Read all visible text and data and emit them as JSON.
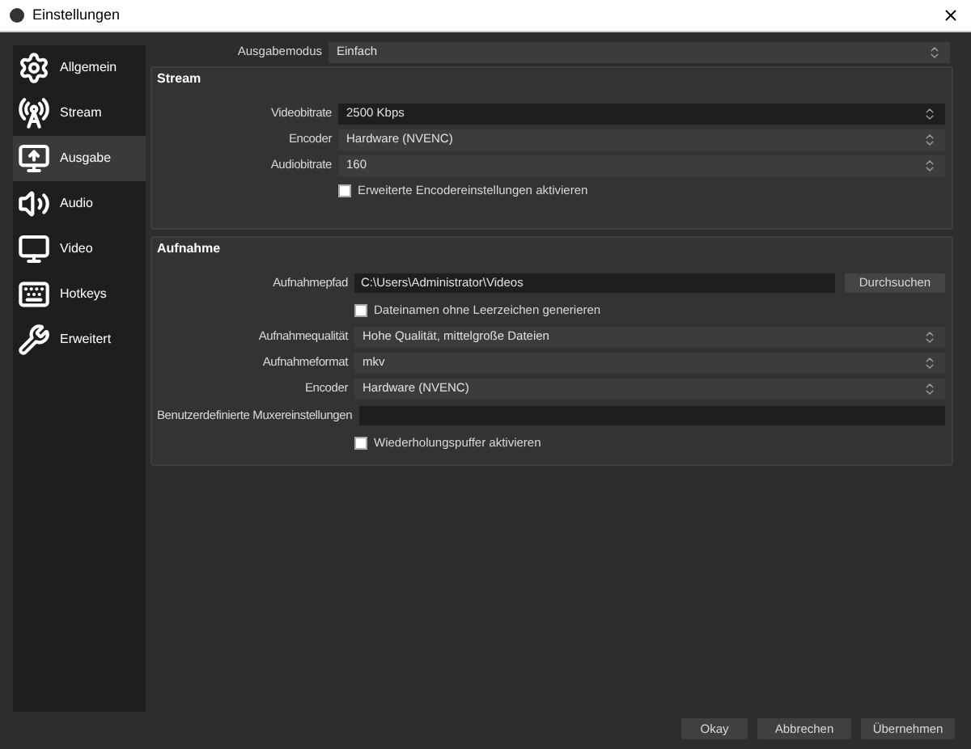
{
  "window": {
    "title": "Einstellungen"
  },
  "sidebar": {
    "items": [
      {
        "label": "Allgemein",
        "selected": false
      },
      {
        "label": "Stream",
        "selected": false
      },
      {
        "label": "Ausgabe",
        "selected": true
      },
      {
        "label": "Audio",
        "selected": false
      },
      {
        "label": "Video",
        "selected": false
      },
      {
        "label": "Hotkeys",
        "selected": false
      },
      {
        "label": "Erweitert",
        "selected": false
      }
    ]
  },
  "output_mode": {
    "label": "Ausgabemodus",
    "value": "Einfach"
  },
  "groups": [
    {
      "title": "Stream",
      "rows": [
        {
          "kind": "spinbox",
          "label": "Videobitrate",
          "value": "2500 Kbps"
        },
        {
          "kind": "dropdown",
          "label": "Encoder",
          "value": "Hardware (NVENC)"
        },
        {
          "kind": "dropdown",
          "label": "Audiobitrate",
          "value": "160"
        },
        {
          "kind": "checkbox",
          "label": "Erweiterte Encodereinstellungen aktivieren",
          "checked": false
        }
      ]
    },
    {
      "title": "Aufnahme",
      "rows": [
        {
          "kind": "path",
          "label": "Aufnahmepfad",
          "value": "C:\\Users\\Administrator\\Videos",
          "button": "Durchsuchen"
        },
        {
          "kind": "checkbox",
          "label": "Dateinamen ohne Leerzeichen generieren",
          "checked": false
        },
        {
          "kind": "dropdown",
          "label": "Aufnahmequalität",
          "value": "Hohe Qualität, mittelgroße Dateien"
        },
        {
          "kind": "dropdown",
          "label": "Aufnahmeformat",
          "value": "mkv"
        },
        {
          "kind": "dropdown",
          "label": "Encoder",
          "value": "Hardware (NVENC)"
        },
        {
          "kind": "text",
          "label": "Benutzerdefinierte Muxereinstellungen"
        },
        {
          "kind": "checkbox",
          "label": "Wiederholungspuffer aktivieren",
          "checked": false
        }
      ]
    }
  ],
  "buttons": [
    "Okay",
    "Abbrechen",
    "Übernehmen"
  ]
}
